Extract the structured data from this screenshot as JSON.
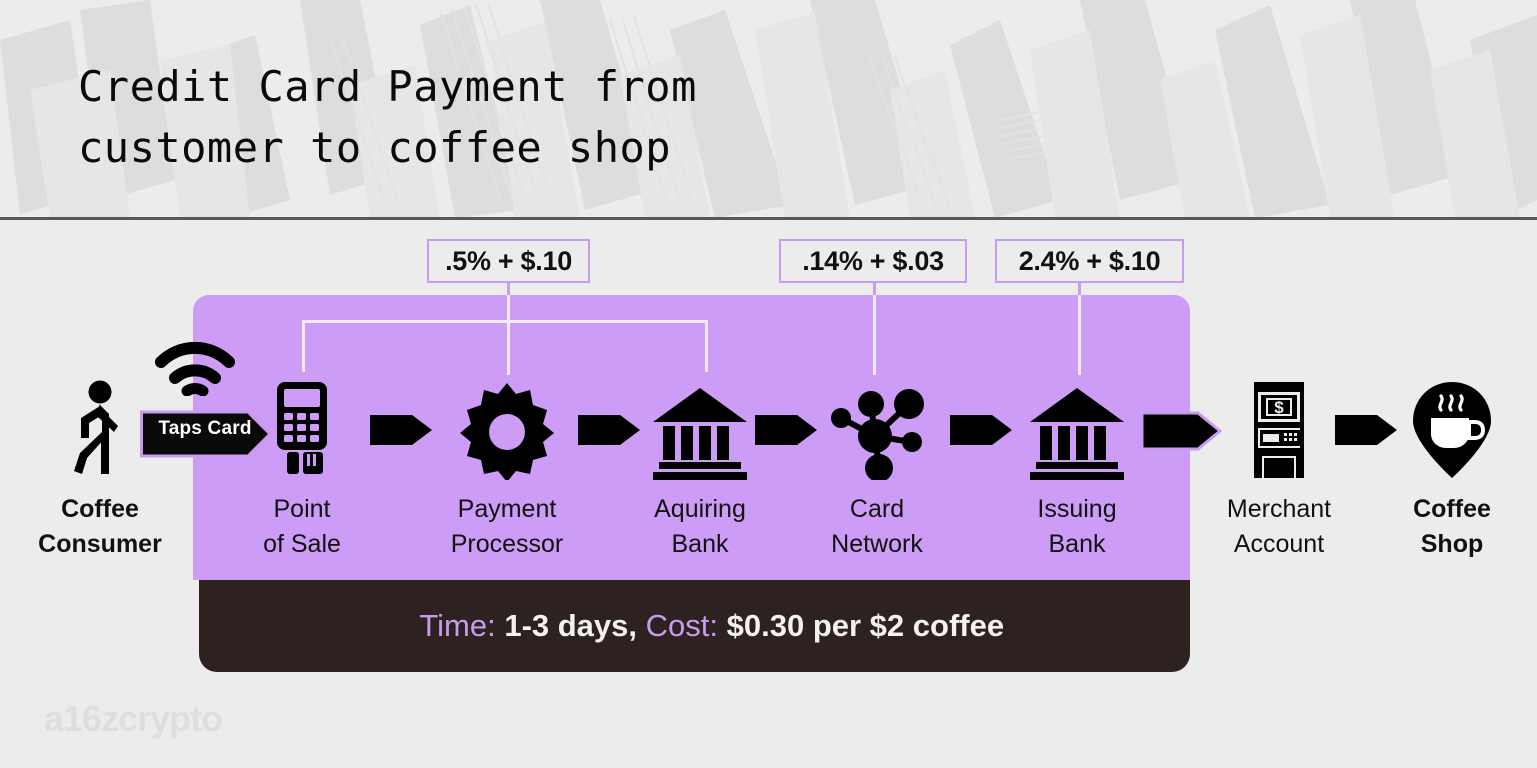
{
  "header": {
    "title": "Credit Card Payment from\ncustomer to coffee shop"
  },
  "fees": [
    {
      "label": ".5% + $.10"
    },
    {
      "label": ".14% + $.03"
    },
    {
      "label": "2.4% + $.10"
    }
  ],
  "flow": {
    "taps_card_label": "Taps Card",
    "nodes": [
      {
        "icon": "walking-person-icon",
        "label": "Coffee\nConsumer",
        "bold": true,
        "inside_panel": false
      },
      {
        "icon": "card-terminal-icon",
        "label": "Point\nof Sale",
        "bold": false,
        "inside_panel": true
      },
      {
        "icon": "gear-icon",
        "label": "Payment\nProcessor",
        "bold": false,
        "inside_panel": true
      },
      {
        "icon": "bank-icon",
        "label": "Aquiring\nBank",
        "bold": false,
        "inside_panel": true
      },
      {
        "icon": "network-nodes-icon",
        "label": "Card\nNetwork",
        "bold": false,
        "inside_panel": true
      },
      {
        "icon": "bank-icon",
        "label": "Issuing\nBank",
        "bold": false,
        "inside_panel": true
      },
      {
        "icon": "atm-icon",
        "label": "Merchant\nAccount",
        "bold": false,
        "inside_panel": false
      },
      {
        "icon": "coffee-pin-icon",
        "label": "Coffee\nShop",
        "bold": true,
        "inside_panel": false
      }
    ]
  },
  "summary": {
    "time_label": "Time:",
    "time_value": "1-3 days,",
    "cost_label": "Cost:",
    "cost_value": "$0.30 per $2 coffee"
  },
  "watermark": {
    "text": "a16zcrypto"
  },
  "colors": {
    "background": "#ECECEC",
    "panel_purple": "#CD9CF7",
    "accent_purple": "#C99BF0",
    "summary_dark": "#2D2220",
    "ink": "#0A0A0A",
    "divider": "#5D5654",
    "connector_white": "#F4EAFF",
    "watermark_gray": "#DEDEDE"
  }
}
